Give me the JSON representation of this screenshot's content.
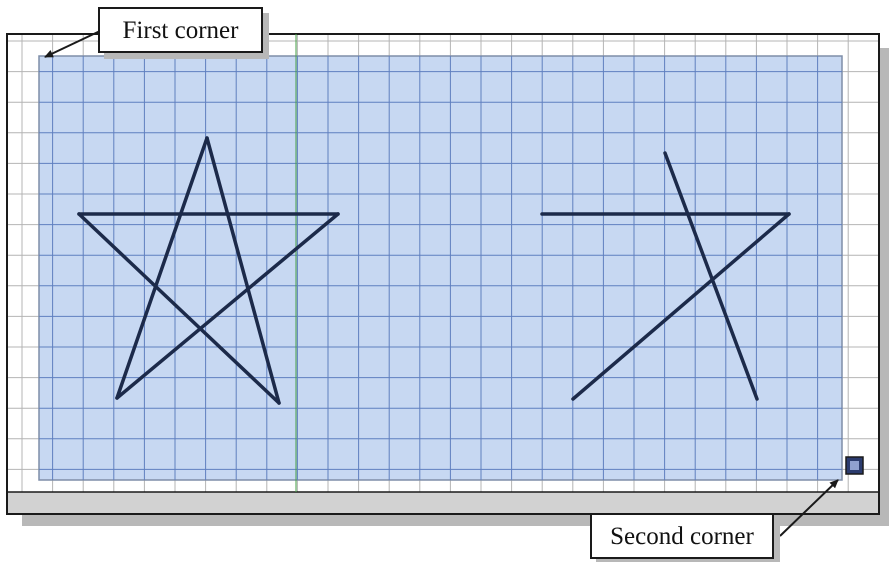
{
  "labels": {
    "first_corner": "First corner",
    "second_corner": "Second corner"
  },
  "colors": {
    "grid_minor": "#b4b4b4",
    "grid_in_selection": "#5f7fbf",
    "selection_fill": "#c7d8f2",
    "selection_border": "#7f8ea8",
    "axis_line": "#46a046",
    "star_stroke": "#1c2a4a",
    "drop_shadow": "#b8b8b8",
    "frame_border": "#1a1a1a"
  },
  "icons": {
    "grip": "grip-handle-icon",
    "arrow": "arrow-pointer-icon"
  }
}
